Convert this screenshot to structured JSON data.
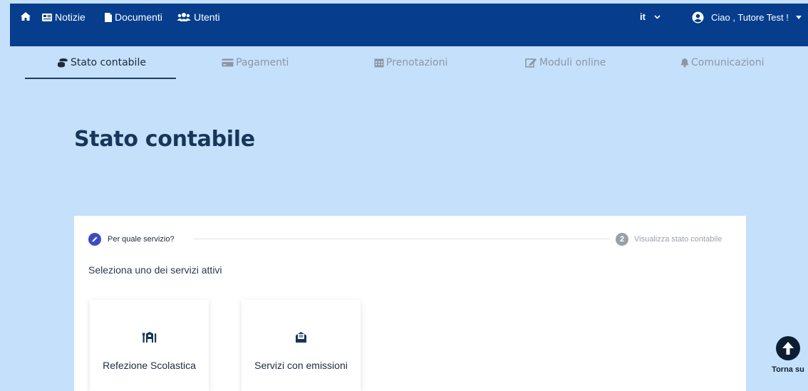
{
  "topbar": {
    "notizie": "Notizie",
    "documenti": "Documenti",
    "utenti": "Utenti",
    "language": "it",
    "greeting": "Ciao , Tutore Test !"
  },
  "tabs": [
    {
      "label": "Stato contabile",
      "icon": "coins-icon",
      "active": true
    },
    {
      "label": "Pagamenti",
      "icon": "credit-card-icon",
      "active": false
    },
    {
      "label": "Prenotazioni",
      "icon": "calendar-icon",
      "active": false
    },
    {
      "label": "Moduli online",
      "icon": "edit-icon",
      "active": false
    },
    {
      "label": "Comunicazioni",
      "icon": "bell-icon",
      "active": false
    }
  ],
  "page": {
    "title": "Stato contabile"
  },
  "stepper": {
    "step1": "Per quale servizio?",
    "step2_number": "2",
    "step2": "Visualizza stato contabile"
  },
  "card": {
    "subtitle": "Seleziona uno dei servizi attivi",
    "services": [
      {
        "label": "Refezione Scolastica",
        "icon": "restaurant-icon"
      },
      {
        "label": "Servizi con emissioni",
        "icon": "envelope-open-icon"
      }
    ]
  },
  "back_to_top": "Torna su",
  "colors": {
    "navbar": "#063d8d",
    "background": "#c5e0fa",
    "step_active": "#3d4dbf"
  }
}
